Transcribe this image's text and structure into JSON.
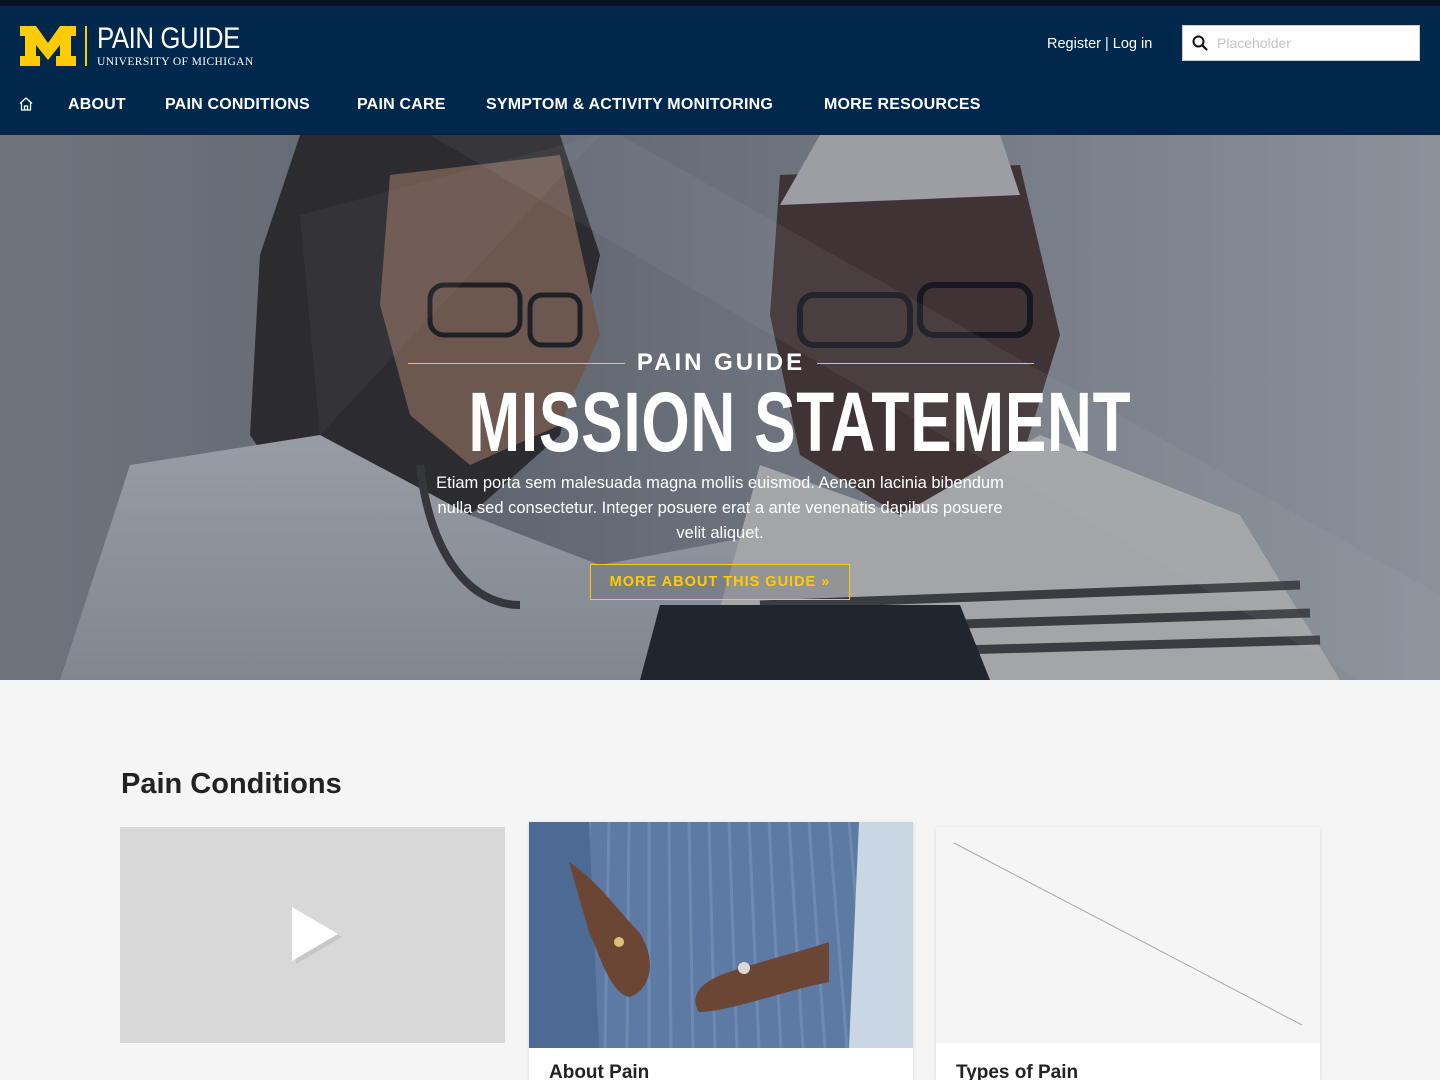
{
  "colors": {
    "navy": "#00274c",
    "maize": "#ffcb05",
    "page_bg": "#f5f5f5"
  },
  "header": {
    "logo_mark": "M",
    "logo_title": "PAIN GUIDE",
    "logo_subtitle": "UNIVERSITY OF MICHIGAN",
    "register": "Register",
    "separator": "|",
    "login": "Log in",
    "search_placeholder": "Placeholder",
    "search_icon": "search-icon"
  },
  "nav": {
    "home_icon": "home-icon",
    "items": [
      {
        "label": "ABOUT"
      },
      {
        "label": "PAIN CONDITIONS"
      },
      {
        "label": "PAIN CARE"
      },
      {
        "label": "SYMPTOM & ACTIVITY MONITORING"
      },
      {
        "label": "MORE RESOURCES"
      }
    ]
  },
  "hero": {
    "eyebrow": "PAIN GUIDE",
    "title": "MISSION STATEMENT",
    "description": "Etiam porta sem malesuada magna mollis euismod. Aenean lacinia bibendum nulla sed consectetur. Integer posuere erat a ante venenatis dapibus posuere velit aliquet.",
    "button": "MORE ABOUT THIS GUIDE »"
  },
  "pain_conditions": {
    "title": "Pain Conditions",
    "cards": [
      {
        "type": "video",
        "label": ""
      },
      {
        "type": "image",
        "label": "About Pain"
      },
      {
        "type": "image-placeholder",
        "label": "Types of Pain"
      }
    ]
  }
}
